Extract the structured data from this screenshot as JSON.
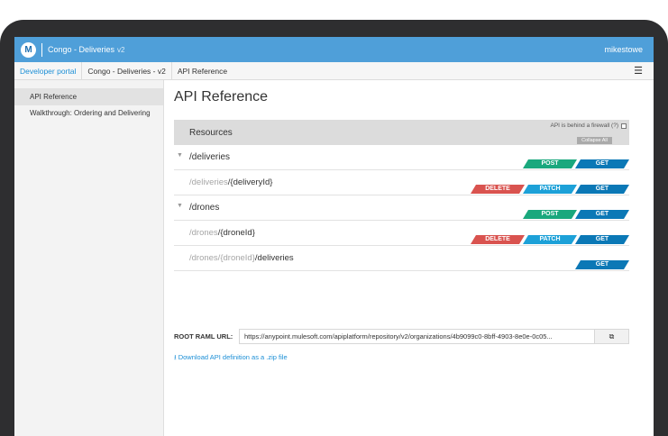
{
  "topbar": {
    "logo": "M",
    "app_title": "Congo - Deliveries",
    "app_version": "v2",
    "user": "mikestowe"
  },
  "breadcrumbs": [
    "Developer portal",
    "Congo - Deliveries - v2",
    "API Reference"
  ],
  "menu_icon": "hamburger-icon",
  "sidebar": {
    "items": [
      {
        "label": "API Reference",
        "active": true
      },
      {
        "label": "Walkthrough: Ordering and Delivering",
        "active": false
      }
    ]
  },
  "main": {
    "title": "API Reference",
    "resources_title": "Resources",
    "firewall_label": "API is behind a firewall (?)",
    "collapse_label": "Collapse All"
  },
  "resources": [
    {
      "type": "top",
      "path_muted": "",
      "path": "/deliveries",
      "methods": [
        "POST",
        "GET"
      ]
    },
    {
      "type": "sub",
      "path_muted": "/deliveries",
      "path": "/{deliveryId}",
      "methods": [
        "DELETE",
        "PATCH",
        "GET"
      ]
    },
    {
      "type": "top",
      "path_muted": "",
      "path": "/drones",
      "methods": [
        "POST",
        "GET"
      ]
    },
    {
      "type": "sub",
      "path_muted": "/drones",
      "path": "/{droneId}",
      "methods": [
        "DELETE",
        "PATCH",
        "GET"
      ]
    },
    {
      "type": "sub",
      "path_muted": "/drones/{droneId}",
      "path": "/deliveries",
      "methods": [
        "GET"
      ]
    }
  ],
  "raml": {
    "label": "ROOT RAML URL:",
    "url": "https://anypoint.mulesoft.com/apiplatform/repository/v2/organizations/4b9099c0-8bff-4903-8e0e-0c05...",
    "copy_icon": "clipboard-icon"
  },
  "download_label": "Download API definition as a .zip file",
  "colors": {
    "topbar": "#4f9fd9",
    "delete": "#d9534f",
    "patch": "#1da1d8",
    "post": "#1aa87d",
    "get": "#0b78b6",
    "link": "#1c8fd6"
  }
}
